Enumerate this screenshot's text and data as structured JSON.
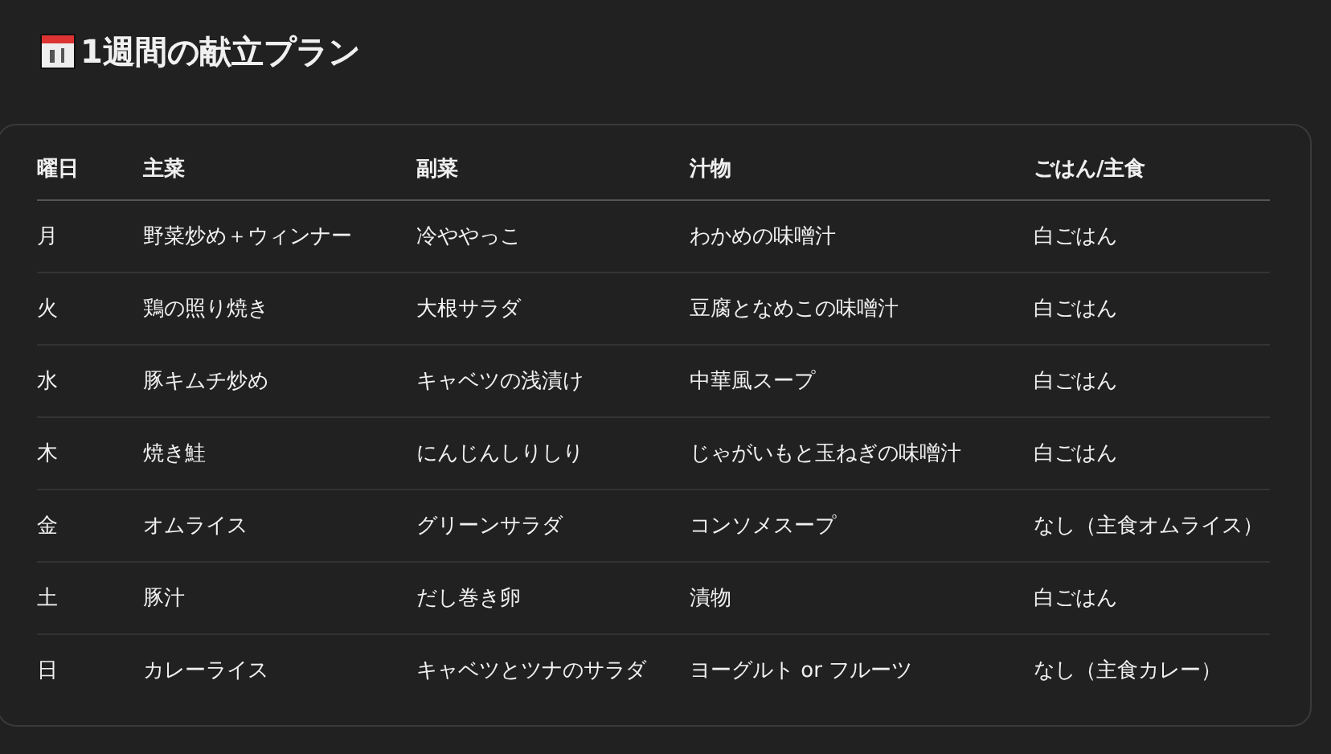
{
  "title": "1週間の献立プラン",
  "table": {
    "columns": [
      "曜日",
      "主菜",
      "副菜",
      "汁物",
      "ごはん/主食"
    ],
    "rows": [
      [
        "月",
        "野菜炒め＋ウィンナー",
        "冷ややっこ",
        "わかめの味噌汁",
        "白ごはん"
      ],
      [
        "火",
        "鶏の照り焼き",
        "大根サラダ",
        "豆腐となめこの味噌汁",
        "白ごはん"
      ],
      [
        "水",
        "豚キムチ炒め",
        "キャベツの浅漬け",
        "中華風スープ",
        "白ごはん"
      ],
      [
        "木",
        "焼き鮭",
        "にんじんしりしり",
        "じゃがいもと玉ねぎの味噌汁",
        "白ごはん"
      ],
      [
        "金",
        "オムライス",
        "グリーンサラダ",
        "コンソメスープ",
        "なし（主食オムライス）"
      ],
      [
        "土",
        "豚汁",
        "だし巻き卵",
        "漬物",
        "白ごはん"
      ],
      [
        "日",
        "カレーライス",
        "キャベツとツナのサラダ",
        "ヨーグルト or フルーツ",
        "なし（主食カレー）"
      ]
    ]
  }
}
